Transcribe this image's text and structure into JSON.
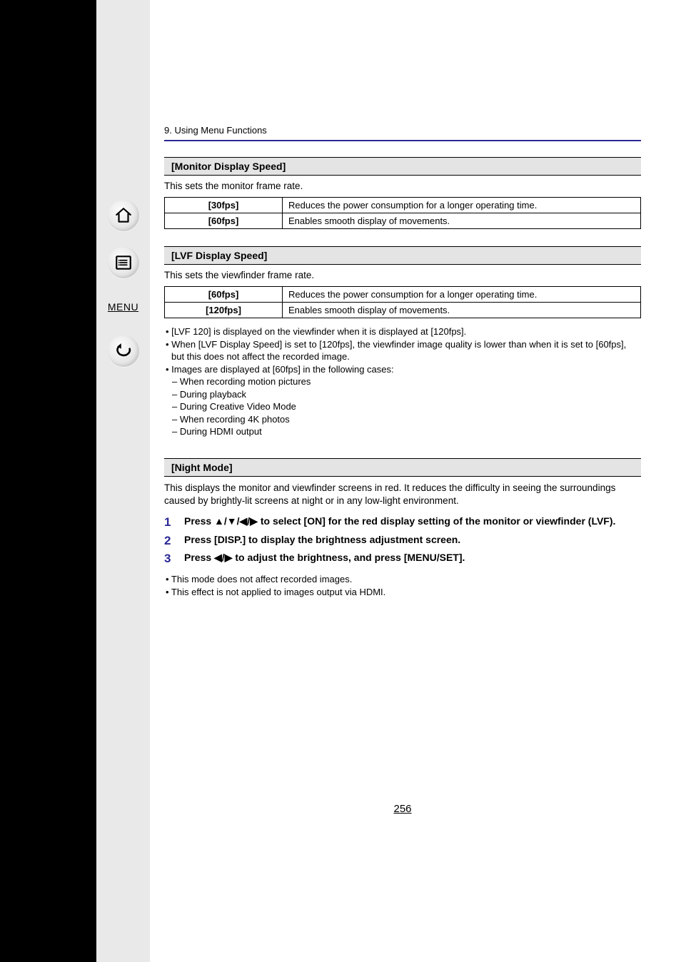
{
  "chapter": "9. Using Menu Functions",
  "sections": {
    "monitor": {
      "heading": "[Monitor Display Speed]",
      "intro": "This sets the monitor frame rate.",
      "rows": [
        {
          "label": "[30fps]",
          "desc": "Reduces the power consumption for a longer operating time."
        },
        {
          "label": "[60fps]",
          "desc": "Enables smooth display of movements."
        }
      ]
    },
    "lvf": {
      "heading": "[LVF Display Speed]",
      "intro": "This sets the viewfinder frame rate.",
      "rows": [
        {
          "label": "[60fps]",
          "desc": "Reduces the power consumption for a longer operating time."
        },
        {
          "label": "[120fps]",
          "desc": "Enables smooth display of movements."
        }
      ],
      "notes": {
        "b1": "• [LVF 120] is displayed on the viewfinder when it is displayed at [120fps].",
        "b2": "• When [LVF Display Speed] is set to [120fps], the viewfinder image quality is lower than when it is set to [60fps], but this does not affect the recorded image.",
        "b3": "• Images are displayed at [60fps] in the following cases:",
        "d1": "– When recording motion pictures",
        "d2": "– During playback",
        "d3": "– During Creative Video Mode",
        "d4": "– When recording 4K photos",
        "d5": "– During HDMI output"
      }
    },
    "night": {
      "heading": "[Night Mode]",
      "desc": "This displays the monitor and viewfinder screens in red. It reduces the difficulty in seeing the surroundings caused by brightly-lit screens at night or in any low-light environment.",
      "steps": [
        {
          "num": "1",
          "text": "Press ▲/▼/◀/▶ to select [ON] for the red display setting of the monitor or viewfinder (LVF)."
        },
        {
          "num": "2",
          "text": "Press [DISP.] to display the brightness adjustment screen."
        },
        {
          "num": "3",
          "text": "Press ◀/▶ to adjust the brightness, and press [MENU/SET]."
        }
      ],
      "notes": {
        "b1": "• This mode does not affect recorded images.",
        "b2": "• This effect is not applied to images output via HDMI."
      }
    }
  },
  "sidebar": {
    "menu_label": "MENU"
  },
  "page_number": "256"
}
